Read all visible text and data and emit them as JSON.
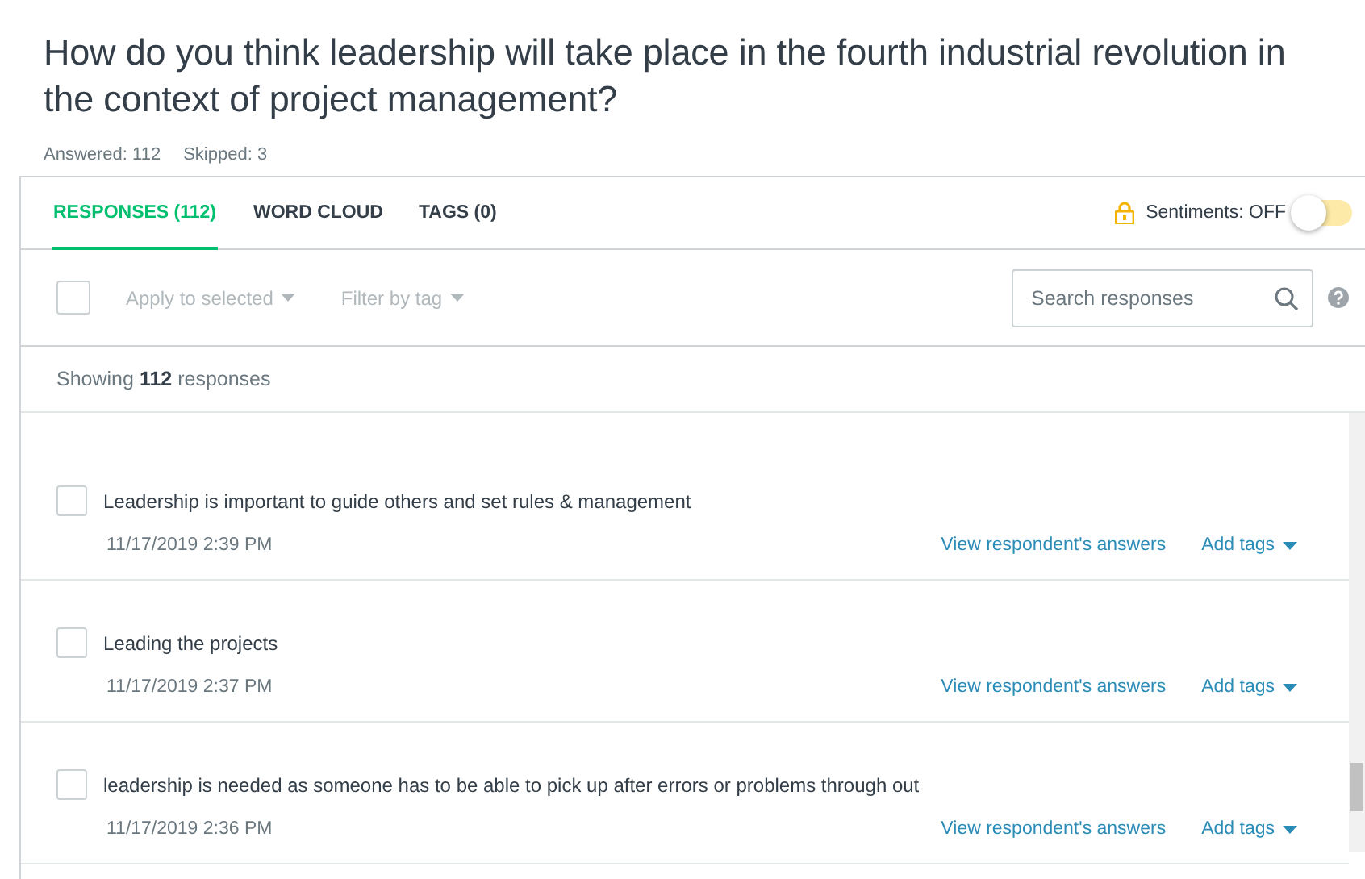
{
  "question": {
    "title": "How do you think leadership will take place in the fourth industrial revolution in the context of project management?",
    "answered": "Answered: 112",
    "skipped": "Skipped: 3"
  },
  "tabs": [
    {
      "label": "RESPONSES (112)",
      "selected": true
    },
    {
      "label": "WORD CLOUD",
      "selected": false
    },
    {
      "label": "TAGS (0)",
      "selected": false
    }
  ],
  "sentiments": {
    "label": "Sentiments: OFF",
    "on": false
  },
  "toolbar": {
    "select_all_checked": false,
    "apply_menu": "Apply to selected",
    "filter_menu": "Filter by tag",
    "search": {
      "placeholder": "Search responses"
    }
  },
  "showing": "Showing **112** responses",
  "responses": [
    {
      "text": "Leadership is important to guide others and set rules & management",
      "date": "11/17/2019 2:39 PM",
      "checked": false,
      "view_link": "View respondent's answers",
      "tags_menu": "Add tags"
    },
    {
      "text": "Leading the projects",
      "date": "11/17/2019 2:37 PM",
      "checked": false,
      "view_link": "View respondent's answers",
      "tags_menu": "Add tags"
    },
    {
      "text": "leadership is needed as someone has to be able to pick up after errors or problems through out",
      "date": "11/17/2019 2:36 PM",
      "checked": false,
      "view_link": "View respondent's answers",
      "tags_menu": "Add tags"
    }
  ]
}
